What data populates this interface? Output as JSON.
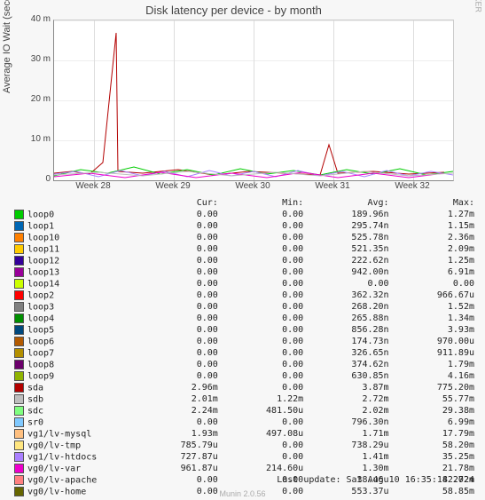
{
  "title": "Disk latency per device - by month",
  "ylabel": "Average IO Wait (seconds)",
  "watermark": "RRDTOOL / TOBI OETIKER",
  "footer_update": "Last update: Sat Aug 10 16:35:18 2024",
  "footer_version": "Munin 2.0.56",
  "chart_data": {
    "type": "line",
    "x_categories": [
      "Week 28",
      "Week 29",
      "Week 30",
      "Week 31",
      "Week 32"
    ],
    "y_ticks": [
      "0",
      "10 m",
      "20 m",
      "30 m",
      "40 m"
    ],
    "ylim": [
      0,
      0.04
    ],
    "xlabel": "",
    "ylabel": "Average IO Wait (seconds)",
    "note": "Many overlapping noisy series near zero; notable red (loop2) spike to ~37m in Week 28 and ~9m in Week 31; baseline noise band roughly 0–5m across all weeks.",
    "series_summary": [
      {
        "name": "loop0",
        "color": "#00cc00",
        "cur": "0.00",
        "min": "0.00",
        "avg": "189.96n",
        "max": "1.27m"
      },
      {
        "name": "loop1",
        "color": "#0066b3",
        "cur": "0.00",
        "min": "0.00",
        "avg": "295.74n",
        "max": "1.15m"
      },
      {
        "name": "loop10",
        "color": "#ff8000",
        "cur": "0.00",
        "min": "0.00",
        "avg": "525.78n",
        "max": "2.36m"
      },
      {
        "name": "loop11",
        "color": "#ffcc00",
        "cur": "0.00",
        "min": "0.00",
        "avg": "521.35n",
        "max": "2.09m"
      },
      {
        "name": "loop12",
        "color": "#330099",
        "cur": "0.00",
        "min": "0.00",
        "avg": "222.62n",
        "max": "1.25m"
      },
      {
        "name": "loop13",
        "color": "#990099",
        "cur": "0.00",
        "min": "0.00",
        "avg": "942.00n",
        "max": "6.91m"
      },
      {
        "name": "loop14",
        "color": "#ccff00",
        "cur": "0.00",
        "min": "0.00",
        "avg": "0.00",
        "max": "0.00"
      },
      {
        "name": "loop2",
        "color": "#ff0000",
        "cur": "0.00",
        "min": "0.00",
        "avg": "362.32n",
        "max": "966.67u"
      },
      {
        "name": "loop3",
        "color": "#808080",
        "cur": "0.00",
        "min": "0.00",
        "avg": "268.20n",
        "max": "1.52m"
      },
      {
        "name": "loop4",
        "color": "#008f00",
        "cur": "0.00",
        "min": "0.00",
        "avg": "265.88n",
        "max": "1.34m"
      },
      {
        "name": "loop5",
        "color": "#00487d",
        "cur": "0.00",
        "min": "0.00",
        "avg": "856.28n",
        "max": "3.93m"
      },
      {
        "name": "loop6",
        "color": "#b35a00",
        "cur": "0.00",
        "min": "0.00",
        "avg": "174.73n",
        "max": "970.00u"
      },
      {
        "name": "loop7",
        "color": "#b38f00",
        "cur": "0.00",
        "min": "0.00",
        "avg": "326.65n",
        "max": "911.89u"
      },
      {
        "name": "loop8",
        "color": "#6b006b",
        "cur": "0.00",
        "min": "0.00",
        "avg": "374.62n",
        "max": "1.79m"
      },
      {
        "name": "loop9",
        "color": "#8fb300",
        "cur": "0.00",
        "min": "0.00",
        "avg": "630.85n",
        "max": "4.16m"
      },
      {
        "name": "sda",
        "color": "#b30000",
        "cur": "2.96m",
        "min": "0.00",
        "avg": "3.87m",
        "max": "775.20m"
      },
      {
        "name": "sdb",
        "color": "#bebebe",
        "cur": "2.01m",
        "min": "1.22m",
        "avg": "2.72m",
        "max": "55.77m"
      },
      {
        "name": "sdc",
        "color": "#80ff80",
        "cur": "2.24m",
        "min": "481.50u",
        "avg": "2.02m",
        "max": "29.38m"
      },
      {
        "name": "sr0",
        "color": "#80c9ff",
        "cur": "0.00",
        "min": "0.00",
        "avg": "796.30n",
        "max": "6.99m"
      },
      {
        "name": "vg1/lv-mysql",
        "color": "#ffc080",
        "cur": "1.93m",
        "min": "497.08u",
        "avg": "1.71m",
        "max": "17.79m"
      },
      {
        "name": "vg0/lv-tmp",
        "color": "#ffe680",
        "cur": "785.79u",
        "min": "0.00",
        "avg": "738.29u",
        "max": "58.20m"
      },
      {
        "name": "vg1/lv-htdocs",
        "color": "#aa80ff",
        "cur": "727.87u",
        "min": "0.00",
        "avg": "1.41m",
        "max": "35.25m"
      },
      {
        "name": "vg0/lv-var",
        "color": "#ee00cc",
        "cur": "961.87u",
        "min": "214.60u",
        "avg": "1.30m",
        "max": "21.78m"
      },
      {
        "name": "vg0/lv-apache",
        "color": "#ff8080",
        "cur": "0.00",
        "min": "0.00",
        "avg": "38.46u",
        "max": "42.72m"
      },
      {
        "name": "vg0/lv-home",
        "color": "#666600",
        "cur": "0.00",
        "min": "0.00",
        "avg": "553.37u",
        "max": "58.85m"
      }
    ]
  },
  "legend_headers": {
    "cur": "Cur:",
    "min": "Min:",
    "avg": "Avg:",
    "max": "Max:"
  }
}
